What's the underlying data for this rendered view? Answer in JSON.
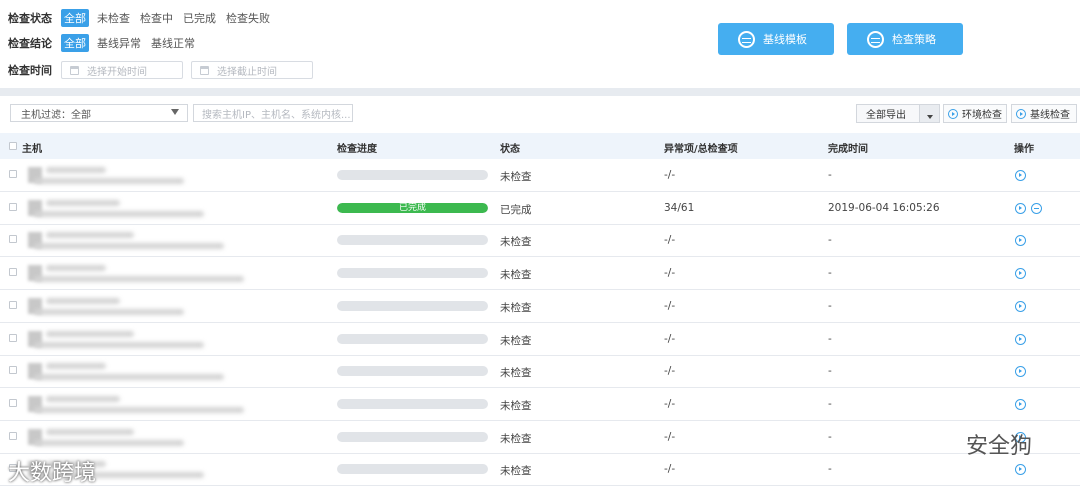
{
  "filters": {
    "status": {
      "label": "检查状态",
      "options": [
        "全部",
        "未检查",
        "检查中",
        "已完成",
        "检查失败"
      ],
      "active": 0
    },
    "result": {
      "label": "检查结论",
      "options": [
        "全部",
        "基线异常",
        "基线正常"
      ],
      "active": 0
    },
    "time": {
      "label": "检查时间",
      "start_placeholder": "选择开始时间",
      "end_placeholder": "选择截止时间"
    }
  },
  "actions": {
    "template_button": "基线模板",
    "policy_button": "检查策略"
  },
  "toolbar": {
    "host_filter": "主机过滤：全部",
    "search_placeholder": "搜索主机IP、主机名、系统内核...",
    "export_label": "全部导出",
    "env_check_label": "环境检查",
    "baseline_check_label": "基线检查"
  },
  "table": {
    "headers": [
      "主机",
      "检查进度",
      "状态",
      "异常项/总检查项",
      "完成时间",
      "操作"
    ],
    "rows": [
      {
        "progress": 0,
        "progress_label": "",
        "status": "未检查",
        "ratio": "-/-",
        "time": "-",
        "actions": [
          "play"
        ]
      },
      {
        "progress": 1,
        "progress_label": "已完成",
        "status": "已完成",
        "ratio": "34/61",
        "time": "2019-06-04 16:05:26",
        "actions": [
          "play",
          "minus"
        ]
      },
      {
        "progress": 0,
        "progress_label": "",
        "status": "未检查",
        "ratio": "-/-",
        "time": "-",
        "actions": [
          "play"
        ]
      },
      {
        "progress": 0,
        "progress_label": "",
        "status": "未检查",
        "ratio": "-/-",
        "time": "-",
        "actions": [
          "play"
        ]
      },
      {
        "progress": 0,
        "progress_label": "",
        "status": "未检查",
        "ratio": "-/-",
        "time": "-",
        "actions": [
          "play"
        ]
      },
      {
        "progress": 0,
        "progress_label": "",
        "status": "未检查",
        "ratio": "-/-",
        "time": "-",
        "actions": [
          "play"
        ]
      },
      {
        "progress": 0,
        "progress_label": "",
        "status": "未检查",
        "ratio": "-/-",
        "time": "-",
        "actions": [
          "play"
        ]
      },
      {
        "progress": 0,
        "progress_label": "",
        "status": "未检查",
        "ratio": "-/-",
        "time": "-",
        "actions": [
          "play"
        ]
      },
      {
        "progress": 0,
        "progress_label": "",
        "status": "未检查",
        "ratio": "-/-",
        "time": "-",
        "actions": [
          "play"
        ]
      },
      {
        "progress": 0,
        "progress_label": "",
        "status": "未检查",
        "ratio": "-/-",
        "time": "-",
        "actions": [
          "play"
        ]
      }
    ]
  },
  "watermarks": {
    "left": "大数跨境",
    "right": "安全狗"
  },
  "colors": {
    "accent": "#45aef0",
    "success": "#3cb94f",
    "header_bg": "#eef4fb"
  }
}
